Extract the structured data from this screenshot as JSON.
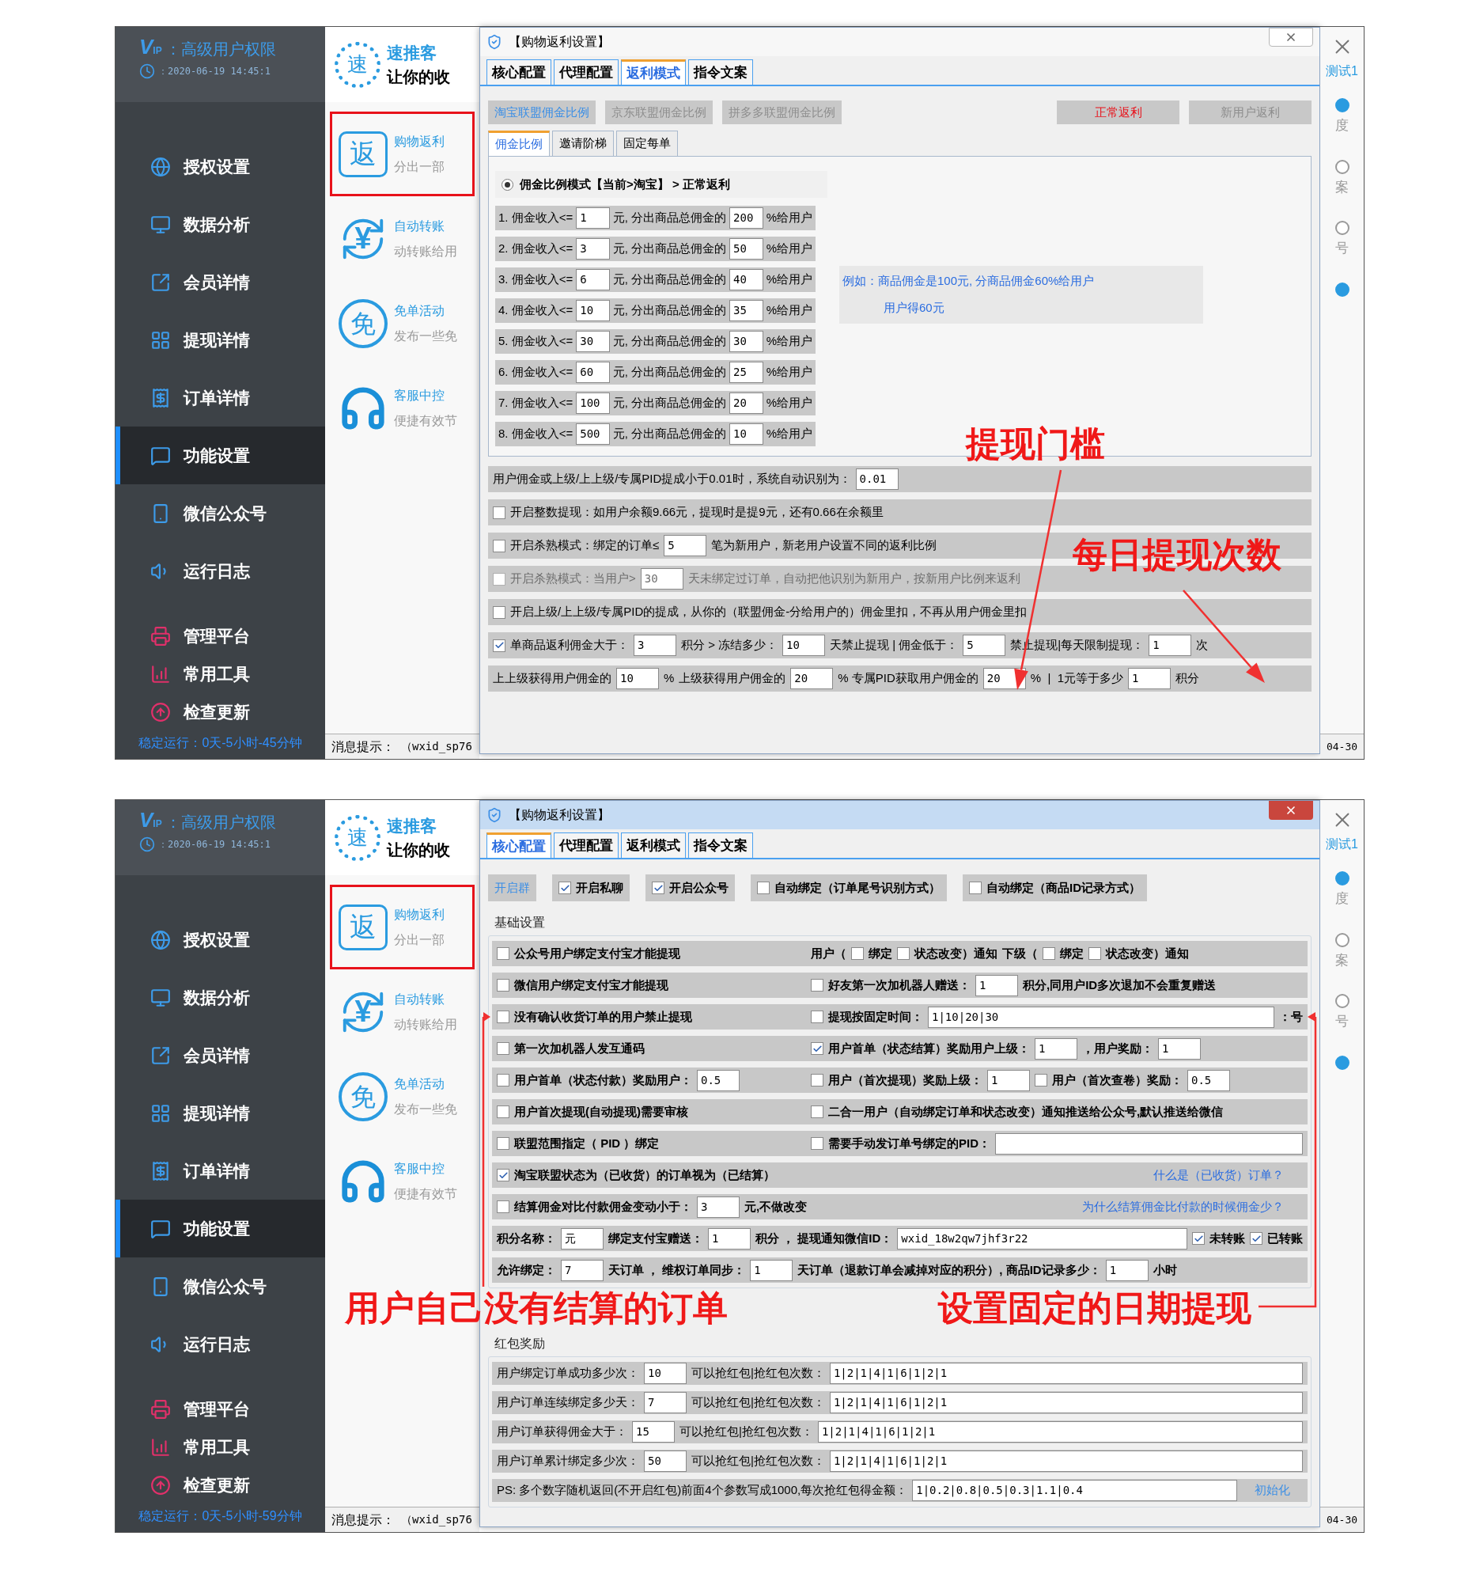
{
  "screens": [
    {
      "sidebar": {
        "vip_mark": "V",
        "vip_sub": "IP",
        "vip_label": "：高级用户权限",
        "datetime": "：2020-06-19 14:45:1",
        "nav": [
          {
            "label": "授权设置",
            "selected": false
          },
          {
            "label": "数据分析",
            "selected": false
          },
          {
            "label": "会员详情",
            "selected": false
          },
          {
            "label": "提现详情",
            "selected": false
          },
          {
            "label": "订单详情",
            "selected": false
          },
          {
            "label": "功能设置",
            "selected": true
          },
          {
            "label": "微信公众号",
            "selected": false
          },
          {
            "label": "运行日志",
            "selected": false
          }
        ],
        "tools": [
          {
            "label": "管理平台",
            "selected": false
          },
          {
            "label": "常用工具",
            "selected": false
          },
          {
            "label": "检查更新",
            "selected": false
          }
        ],
        "uptime": "稳定运行：0天-5小时-45分钟"
      },
      "app": {
        "logo_char": "速",
        "title": "速推客",
        "slogan": "让你的收",
        "features": [
          {
            "kind": "box",
            "icon_text": "返",
            "title": "购物返利",
            "desc": "分出一部",
            "selected": true
          },
          {
            "kind": "swap",
            "icon_text": "¥",
            "title": "自动转账",
            "desc": "动转账给用",
            "selected": false
          },
          {
            "kind": "circle",
            "icon_text": "免",
            "title": "免单活动",
            "desc": "发布一些免",
            "selected": false
          },
          {
            "kind": "headset",
            "title": "客服中控",
            "desc": "便捷有效节",
            "selected": false
          }
        ]
      },
      "status_bar": {
        "label": "消息提示：",
        "message": "（wxid_sp76",
        "date": "04-30"
      },
      "right_strip": {
        "link": "测试1",
        "items": [
          {
            "label": "度",
            "selected": true
          },
          {
            "label": "案",
            "selected": false
          },
          {
            "label": "号",
            "selected": false
          },
          {
            "selected": true
          }
        ]
      },
      "dialog": {
        "kind": "rebate",
        "title": "【购物返利设置】",
        "active": false,
        "tabs": [
          {
            "label": "核心配置",
            "selected": false
          },
          {
            "label": "代理配置",
            "selected": false
          },
          {
            "label": "返利模式",
            "selected": true
          },
          {
            "label": "指令文案",
            "selected": false
          }
        ],
        "platforms": [
          {
            "label": "淘宝联盟佣金比例",
            "selected": true
          },
          {
            "label": "京东联盟佣金比例",
            "selected": false
          },
          {
            "label": "拼多多联盟佣金比例",
            "selected": false
          }
        ],
        "modes": [
          {
            "label": "正常返利",
            "selected": true
          },
          {
            "label": "新用户返利",
            "selected": false
          }
        ],
        "subtabs": [
          {
            "label": "佣金比例",
            "selected": true
          },
          {
            "label": "邀请阶梯",
            "selected": false
          },
          {
            "label": "固定每单",
            "selected": false
          }
        ],
        "radio": {
          "label": "佣金比例模式【当前>淘宝】 > 正常返利",
          "selected": true
        },
        "tiers": [
          {
            "label": "1. 佣金收入<=",
            "max": "1",
            "middle": "元, 分出商品总佣金的",
            "percent": "200",
            "unit": "%给用户"
          },
          {
            "label": "2. 佣金收入<=",
            "max": "3",
            "middle": "元, 分出商品总佣金的",
            "percent": "50",
            "unit": "%给用户"
          },
          {
            "label": "3. 佣金收入<=",
            "max": "6",
            "middle": "元, 分出商品总佣金的",
            "percent": "40",
            "unit": "%给用户"
          },
          {
            "label": "4. 佣金收入<=",
            "max": "10",
            "middle": "元, 分出商品总佣金的",
            "percent": "35",
            "unit": "%给用户"
          },
          {
            "label": "5. 佣金收入<=",
            "max": "30",
            "middle": "元, 分出商品总佣金的",
            "percent": "30",
            "unit": "%给用户"
          },
          {
            "label": "6. 佣金收入<=",
            "max": "60",
            "middle": "元, 分出商品总佣金的",
            "percent": "25",
            "unit": "%给用户"
          },
          {
            "label": "7. 佣金收入<=",
            "max": "100",
            "middle": "元, 分出商品总佣金的",
            "percent": "20",
            "unit": "%给用户"
          },
          {
            "label": "8. 佣金收入<=",
            "max": "500",
            "middle": "元, 分出商品总佣金的",
            "percent": "10",
            "unit": "%给用户"
          }
        ],
        "example": [
          "例如：商品佣金是100元, 分商品佣金60%给用户",
          "用户得60元"
        ],
        "rows": [
          {
            "disabled": false,
            "cells": [
              [
                {
                  "kind": "text",
                  "text": "用户佣金或上级/上上级/专属PID提成小于0.01时，系统自动识别为："
                },
                {
                  "kind": "field",
                  "value": "0.01"
                }
              ]
            ]
          },
          {
            "disabled": false,
            "cells": [
              [
                {
                  "kind": "check",
                  "label": "开启整数提现：如用户余额9.66元，提现时是提9元，还有0.66在余额里",
                  "checked": false
                }
              ]
            ]
          },
          {
            "disabled": false,
            "cells": [
              [
                {
                  "kind": "check",
                  "label": "开启杀熟模式：绑定的订单≤",
                  "checked": false
                },
                {
                  "kind": "field",
                  "value": "5"
                },
                {
                  "kind": "text",
                  "text": "笔为新用户，新老用户设置不同的返利比例"
                }
              ]
            ]
          },
          {
            "disabled": true,
            "cells": [
              [
                {
                  "kind": "check",
                  "label": "开启杀熟模式：当用户>",
                  "checked": false
                },
                {
                  "kind": "field",
                  "value": "30"
                },
                {
                  "kind": "text",
                  "text": "天未绑定过订单，自动把他识别为新用户，按新用户比例来返利"
                }
              ]
            ]
          },
          {
            "disabled": false,
            "cells": [
              [
                {
                  "kind": "check",
                  "label": "开启上级/上上级/专属PID的提成，从你的（联盟佣金-分给用户的）佣金里扣，不再从用户佣金里扣",
                  "checked": false
                }
              ]
            ]
          },
          {
            "disabled": false,
            "cells": [
              [
                {
                  "kind": "check",
                  "label": "单商品返利佣金大于：",
                  "checked": true
                },
                {
                  "kind": "field",
                  "value": "3"
                },
                {
                  "kind": "text",
                  "text": "积分 > 冻结多少："
                },
                {
                  "kind": "field",
                  "value": "10"
                },
                {
                  "kind": "text",
                  "text": "天禁止提现 | 佣金低于："
                },
                {
                  "kind": "field",
                  "value": "5"
                },
                {
                  "kind": "text",
                  "text": "禁止提现|每天限制提现："
                },
                {
                  "kind": "field",
                  "value": "1"
                },
                {
                  "kind": "text",
                  "text": "次"
                }
              ]
            ]
          },
          {
            "disabled": false,
            "cells": [
              [
                {
                  "kind": "text",
                  "text": "上上级获得用户佣金的"
                },
                {
                  "kind": "field",
                  "value": "10"
                },
                {
                  "kind": "text",
                  "text": "%"
                },
                {
                  "kind": "text",
                  "text": "上级获得用户佣金的"
                },
                {
                  "kind": "field",
                  "value": "20"
                },
                {
                  "kind": "text",
                  "text": "% 专属PID获取用户佣金的"
                },
                {
                  "kind": "field",
                  "value": "20"
                },
                {
                  "kind": "text",
                  "text": "%  |  1元等于多少"
                },
                {
                  "kind": "field",
                  "value": "1"
                },
                {
                  "kind": "text",
                  "text": "积分"
                }
              ]
            ]
          }
        ]
      },
      "annotations": [
        {
          "text": "提现门槛"
        },
        {
          "text": "每日提现次数"
        }
      ]
    },
    {
      "sidebar": {
        "vip_mark": "V",
        "vip_sub": "IP",
        "vip_label": "：高级用户权限",
        "datetime": "：2020-06-19 14:45:1",
        "nav": [
          {
            "label": "授权设置",
            "selected": false
          },
          {
            "label": "数据分析",
            "selected": false
          },
          {
            "label": "会员详情",
            "selected": false
          },
          {
            "label": "提现详情",
            "selected": false
          },
          {
            "label": "订单详情",
            "selected": false
          },
          {
            "label": "功能设置",
            "selected": true
          },
          {
            "label": "微信公众号",
            "selected": false
          },
          {
            "label": "运行日志",
            "selected": false
          }
        ],
        "tools": [
          {
            "label": "管理平台",
            "selected": false
          },
          {
            "label": "常用工具",
            "selected": false
          },
          {
            "label": "检查更新",
            "selected": false
          }
        ],
        "uptime": "稳定运行：0天-5小时-59分钟"
      },
      "app": {
        "logo_char": "速",
        "title": "速推客",
        "slogan": "让你的收",
        "features": [
          {
            "kind": "box",
            "icon_text": "返",
            "title": "购物返利",
            "desc": "分出一部",
            "selected": true
          },
          {
            "kind": "swap",
            "icon_text": "¥",
            "title": "自动转账",
            "desc": "动转账给用",
            "selected": false
          },
          {
            "kind": "circle",
            "icon_text": "免",
            "title": "免单活动",
            "desc": "发布一些免",
            "selected": false
          },
          {
            "kind": "headset",
            "title": "客服中控",
            "desc": "便捷有效节",
            "selected": false
          }
        ]
      },
      "status_bar": {
        "label": "消息提示：",
        "message": "（wxid_sp76",
        "date": "04-30"
      },
      "right_strip": {
        "link": "测试1",
        "items": [
          {
            "label": "度",
            "selected": true
          },
          {
            "label": "案",
            "selected": false
          },
          {
            "label": "号",
            "selected": false
          },
          {
            "selected": true
          }
        ]
      },
      "dialog": {
        "kind": "core",
        "title": "【购物返利设置】",
        "active": true,
        "tabs": [
          {
            "label": "核心配置",
            "selected": true
          },
          {
            "label": "代理配置",
            "selected": false
          },
          {
            "label": "返利模式",
            "selected": false
          },
          {
            "label": "指令文案",
            "selected": false
          }
        ],
        "toggles": [
          {
            "kind": "button",
            "label": "开启群"
          },
          {
            "kind": "check",
            "label": "开启私聊",
            "checked": true
          },
          {
            "kind": "check",
            "label": "开启公众号",
            "checked": true
          },
          {
            "kind": "check",
            "label": "自动绑定（订单尾号识别方式）",
            "checked": false
          },
          {
            "kind": "check",
            "label": "自动绑定（商品ID记录方式）",
            "checked": false
          }
        ],
        "groups": [
          {
            "title": "基础设置",
            "rows": [
              {
                "cells": [
                  [
                    {
                      "kind": "check",
                      "label": "公众号用户绑定支付宝才能提现",
                      "checked": false
                    }
                  ],
                  [
                    {
                      "kind": "text",
                      "text": "用户（"
                    },
                    {
                      "kind": "check",
                      "label": "绑定",
                      "checked": false
                    },
                    {
                      "kind": "check",
                      "label": "状态改变）通知",
                      "checked": false
                    },
                    {
                      "kind": "text",
                      "text": "下级（"
                    },
                    {
                      "kind": "check",
                      "label": "绑定",
                      "checked": false
                    },
                    {
                      "kind": "check",
                      "label": "状态改变）通知",
                      "checked": false
                    }
                  ]
                ]
              },
              {
                "cells": [
                  [
                    {
                      "kind": "check",
                      "label": "微信用户绑定支付宝才能提现",
                      "checked": false
                    }
                  ],
                  [
                    {
                      "kind": "check",
                      "label": "好友第一次加机器人赠送：",
                      "checked": false
                    },
                    {
                      "kind": "field",
                      "value": "1"
                    },
                    {
                      "kind": "text",
                      "text": "积分,同用户ID多次退加不会重复赠送"
                    }
                  ]
                ]
              },
              {
                "cells": [
                  [
                    {
                      "kind": "check",
                      "label": "没有确认收货订单的用户禁止提现",
                      "checked": false
                    }
                  ],
                  [
                    {
                      "kind": "check",
                      "label": "提现按固定时间：",
                      "checked": false
                    },
                    {
                      "kind": "wide_field",
                      "value": "1|10|20|30"
                    },
                    {
                      "kind": "text",
                      "text": "：号"
                    }
                  ]
                ]
              },
              {
                "cells": [
                  [
                    {
                      "kind": "check",
                      "label": "第一次加机器人发互通码",
                      "checked": false
                    }
                  ],
                  [
                    {
                      "kind": "check",
                      "label": "用户首单（状态结算）奖励用户上级：",
                      "checked": true
                    },
                    {
                      "kind": "field",
                      "value": "1"
                    },
                    {
                      "kind": "text",
                      "text": "，用户奖励："
                    },
                    {
                      "kind": "field",
                      "value": "1"
                    }
                  ]
                ]
              },
              {
                "cells": [
                  [
                    {
                      "kind": "check",
                      "label": "用户首单（状态付款）奖励用户：",
                      "checked": false
                    },
                    {
                      "kind": "field",
                      "value": "0.5"
                    }
                  ],
                  [
                    {
                      "kind": "check",
                      "label": "用户（首次提现）奖励上级：",
                      "checked": false
                    },
                    {
                      "kind": "field",
                      "value": "1"
                    },
                    {
                      "kind": "check",
                      "label": "用户（首次查卷）奖励：",
                      "checked": false
                    },
                    {
                      "kind": "field",
                      "value": "0.5"
                    }
                  ]
                ]
              },
              {
                "cells": [
                  [
                    {
                      "kind": "check",
                      "label": "用户首次提现(自动提现)需要审核",
                      "checked": false
                    }
                  ],
                  [
                    {
                      "kind": "check",
                      "label": "二合一用户（自动绑定订单和状态改变）通知推送给公众号,默认推送给微信",
                      "checked": false
                    }
                  ]
                ]
              },
              {
                "cells": [
                  [
                    {
                      "kind": "check",
                      "label": "联盟范围指定（ PID ）绑定",
                      "checked": false
                    }
                  ],
                  [
                    {
                      "kind": "check",
                      "label": "需要手动发订单号绑定的PID：",
                      "checked": false
                    },
                    {
                      "kind": "wide_field"
                    }
                  ]
                ]
              },
              {
                "cells": [
                  [
                    {
                      "kind": "check",
                      "label": "淘宝联盟状态为（已收货）的订单视为（已结算）",
                      "checked": true
                    },
                    {
                      "kind": "link",
                      "text": "什么是（已收货）订单？"
                    }
                  ]
                ]
              },
              {
                "cells": [
                  [
                    {
                      "kind": "check",
                      "label": "结算佣金对比付款佣金变动小于：",
                      "checked": false
                    },
                    {
                      "kind": "field",
                      "value": "3"
                    },
                    {
                      "kind": "text",
                      "text": "元,不做改变"
                    },
                    {
                      "kind": "link",
                      "text": "为什么结算佣金比付款的时候佣金少？"
                    }
                  ]
                ]
              },
              {
                "cells": [
                  [
                    {
                      "kind": "text",
                      "text": "积分名称："
                    },
                    {
                      "kind": "field",
                      "value": "元"
                    },
                    {
                      "kind": "text",
                      "text": "绑定支付宝赠送："
                    },
                    {
                      "kind": "field",
                      "value": "1"
                    },
                    {
                      "kind": "text",
                      "text": "积分 ， 提现通知微信ID："
                    },
                    {
                      "kind": "wide_field",
                      "value": "wxid_18w2qw7jhf3r22"
                    },
                    {
                      "kind": "check",
                      "label": "未转账",
                      "checked": true
                    },
                    {
                      "kind": "check",
                      "label": "已转账",
                      "checked": true
                    }
                  ]
                ]
              },
              {
                "cells": [
                  [
                    {
                      "kind": "text",
                      "text": "允许绑定："
                    },
                    {
                      "kind": "field",
                      "value": "7"
                    },
                    {
                      "kind": "text",
                      "text": "天订单 ， 维权订单同步："
                    },
                    {
                      "kind": "field",
                      "value": "1"
                    },
                    {
                      "kind": "text",
                      "text": "天订单（退款订单会减掉对应的积分）, 商品ID记录多少："
                    },
                    {
                      "kind": "field",
                      "value": "1"
                    },
                    {
                      "kind": "text",
                      "text": "小时"
                    }
                  ]
                ]
              }
            ]
          },
          {
            "title": "红包奖励",
            "rows": [
              {
                "cells": [
                  [
                    {
                      "kind": "text",
                      "text": "用户绑定订单成功多少次："
                    },
                    {
                      "kind": "field",
                      "value": "10"
                    },
                    {
                      "kind": "text",
                      "text": "可以抢红包|抢红包次数："
                    },
                    {
                      "kind": "wide_field",
                      "value": "1|2|1|4|1|6|1|2|1"
                    }
                  ]
                ]
              },
              {
                "cells": [
                  [
                    {
                      "kind": "text",
                      "text": "用户订单连续绑定多少天："
                    },
                    {
                      "kind": "field",
                      "value": "7"
                    },
                    {
                      "kind": "text",
                      "text": "可以抢红包|抢红包次数："
                    },
                    {
                      "kind": "wide_field",
                      "value": "1|2|1|4|1|6|1|2|1"
                    }
                  ]
                ]
              },
              {
                "cells": [
                  [
                    {
                      "kind": "text",
                      "text": "用户订单获得佣金大于："
                    },
                    {
                      "kind": "field",
                      "value": "15"
                    },
                    {
                      "kind": "text",
                      "text": "可以抢红包|抢红包次数："
                    },
                    {
                      "kind": "wide_field",
                      "value": "1|2|1|4|1|6|1|2|1"
                    }
                  ]
                ]
              },
              {
                "cells": [
                  [
                    {
                      "kind": "text",
                      "text": "用户订单累计绑定多少次："
                    },
                    {
                      "kind": "field",
                      "value": "50"
                    },
                    {
                      "kind": "text",
                      "text": "可以抢红包|抢红包次数："
                    },
                    {
                      "kind": "wide_field",
                      "value": "1|2|1|4|1|6|1|2|1"
                    }
                  ]
                ]
              },
              {
                "cells": [
                  [
                    {
                      "kind": "text",
                      "text": "PS: 多个数字随机返回(不开启红包)前面4个参数写成1000,每次抢红包得金额："
                    },
                    {
                      "kind": "wide_field",
                      "value": "1|0.2|0.8|0.5|0.3|1.1|0.4"
                    },
                    {
                      "kind": "button",
                      "label": "初始化"
                    }
                  ]
                ]
              }
            ]
          }
        ]
      },
      "annotations": [
        {
          "text": "用户自己没有结算的订单"
        },
        {
          "text": "设置固定的日期提现"
        }
      ]
    }
  ]
}
